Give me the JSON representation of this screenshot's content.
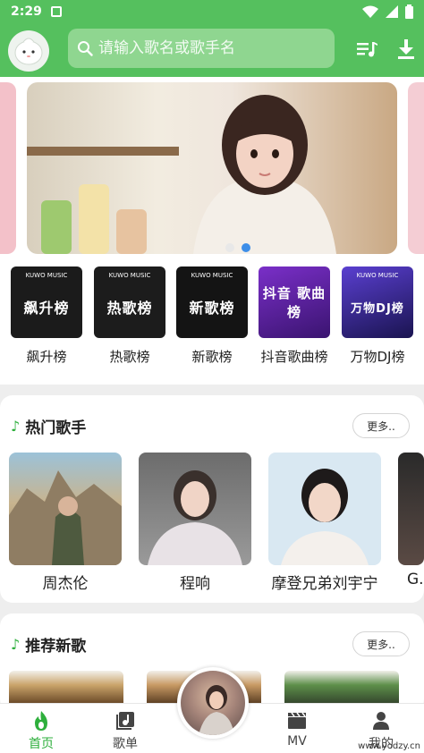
{
  "status": {
    "time": "2:29"
  },
  "search": {
    "placeholder": "请输入歌名或歌手名"
  },
  "charts": [
    {
      "label": "飙升榜",
      "cover_text": "飙升榜",
      "brand": "KUWO MUSIC",
      "color": "#1b1b1b"
    },
    {
      "label": "热歌榜",
      "cover_text": "热歌榜",
      "brand": "KUWO MUSIC",
      "color": "#1c1c1c"
    },
    {
      "label": "新歌榜",
      "cover_text": "新歌榜",
      "brand": "KUWO MUSIC",
      "color": "#141414"
    },
    {
      "label": "抖音歌曲榜",
      "cover_text": "抖音 歌曲榜",
      "brand": "",
      "color": "#5a1f9e"
    },
    {
      "label": "万物DJ榜",
      "cover_text": "万物DJ榜",
      "brand": "KUWO MUSIC",
      "color": "#3b2a8f"
    }
  ],
  "hot_artists": {
    "title": "热门歌手",
    "more": "更多..",
    "items": [
      {
        "name": "周杰伦"
      },
      {
        "name": "程响"
      },
      {
        "name": "摩登兄弟刘宇宁"
      },
      {
        "name": "G."
      }
    ]
  },
  "new_songs": {
    "title": "推荐新歌",
    "more": "更多.."
  },
  "tabs": [
    {
      "label": "首页",
      "icon": "flame-icon",
      "active": true
    },
    {
      "label": "歌单",
      "icon": "playlist-icon",
      "active": false
    },
    {
      "label": "MV",
      "icon": "clapper-icon",
      "active": false
    },
    {
      "label": "我的",
      "icon": "person-icon",
      "active": false
    }
  ],
  "watermark": "www.yodzy.cn",
  "colors": {
    "accent": "#55c05e",
    "active_tab": "#2eaf3c",
    "dot_active": "#3d8ee8"
  }
}
